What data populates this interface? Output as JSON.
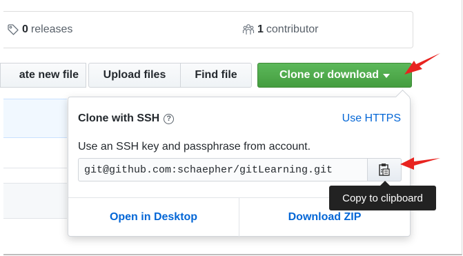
{
  "summary": {
    "releases_count": "0",
    "releases_label": "releases",
    "contributors_count": "1",
    "contributors_label": "contributor"
  },
  "toolbar": {
    "create_new_file": "ate new file",
    "upload_files": "Upload files",
    "find_file": "Find file",
    "clone_or_download": "Clone or download"
  },
  "clone_popover": {
    "title": "Clone with SSH",
    "help_glyph": "?",
    "use_https": "Use HTTPS",
    "description": "Use an SSH key and passphrase from account.",
    "url_value": "git@github.com:schaepher/gitLearning.git",
    "open_in_desktop": "Open in Desktop",
    "download_zip": "Download ZIP"
  },
  "tooltip": {
    "text": "Copy to clipboard"
  },
  "colors": {
    "clone_green": "#4ea64a",
    "link_blue": "#0366d6",
    "annotation_red": "#e8231f",
    "tooltip_bg": "#222222"
  },
  "icons": {
    "releases": "tag-icon",
    "contributors": "people-icon",
    "copy": "clipboard-icon",
    "help": "question-circle-icon"
  }
}
